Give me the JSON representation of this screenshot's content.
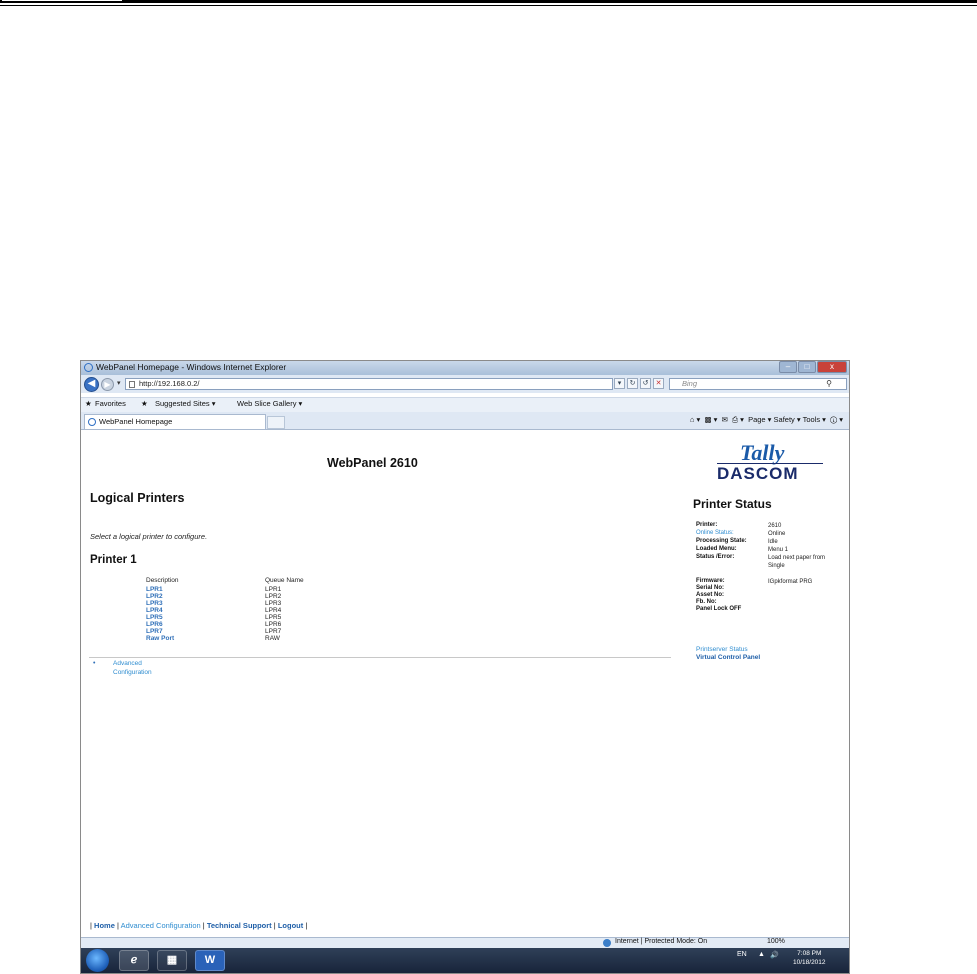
{
  "window": {
    "title": "WebPanel Homepage - Windows Internet Explorer",
    "buttons": {
      "minimize": "–",
      "maximize": "□",
      "close": "x"
    }
  },
  "address_bar": {
    "url": "http://192.168.0.2/",
    "search_placeholder": "Bing"
  },
  "favorites_bar": {
    "favorites": "Favorites",
    "suggested_sites": "Suggested Sites ▾",
    "web_slice_gallery": "Web Slice Gallery ▾"
  },
  "tab": {
    "label": "WebPanel Homepage"
  },
  "command_bar": {
    "items": "Page ▾   Safety ▾   Tools ▾"
  },
  "page": {
    "title": "WebPanel 2610",
    "logo_top": "Tally",
    "logo_bottom": "DASCOM",
    "heading": "Logical Printers",
    "intro": "Select a logical printer to configure.",
    "printer_heading": "Printer 1",
    "columns": {
      "description": "Description",
      "queue": "Queue Name"
    },
    "printers": [
      {
        "description": "LPR1",
        "queue": "LPR1"
      },
      {
        "description": "LPR2",
        "queue": "LPR2"
      },
      {
        "description": "LPR3",
        "queue": "LPR3"
      },
      {
        "description": "LPR4",
        "queue": "LPR4"
      },
      {
        "description": "LPR5",
        "queue": "LPR5"
      },
      {
        "description": "LPR6",
        "queue": "LPR6"
      },
      {
        "description": "LPR7",
        "queue": "LPR7"
      },
      {
        "description": "Raw Port",
        "queue": "RAW"
      }
    ],
    "advanced_link_1": "Advanced",
    "advanced_link_2": "Configuration",
    "status": {
      "heading": "Printer Status",
      "rows": [
        {
          "key": "Printer:",
          "value": "2610"
        },
        {
          "key": "Online Status:",
          "value": "Online"
        },
        {
          "key": "Processing State:",
          "value": "Idle"
        },
        {
          "key": "Loaded Menu:",
          "value": "Menu 1"
        },
        {
          "key": "Status /Error:",
          "value": "Load next paper from Single"
        },
        {
          "key": "Firmware:",
          "value": "IGpkformat PRG"
        },
        {
          "key": "Serial No:",
          "value": ""
        },
        {
          "key": "Asset No:",
          "value": ""
        },
        {
          "key": "Fb. No:",
          "value": ""
        },
        {
          "key": "Panel Lock OFF",
          "value": ""
        }
      ],
      "link_printserver": "Printserver Status",
      "link_vcp": "Virtual Control Panel"
    },
    "footer": {
      "sep": "|",
      "home": "Home",
      "advanced": "Advanced Configuration",
      "support": "Technical Support",
      "logout": "Logout"
    }
  },
  "status_bar": {
    "zone": "Internet | Protected Mode: On",
    "zoom": "100%"
  },
  "taskbar": {
    "word_icon": "W",
    "lang": "EN",
    "time": "7:08 PM",
    "date": "10/18/2012"
  }
}
